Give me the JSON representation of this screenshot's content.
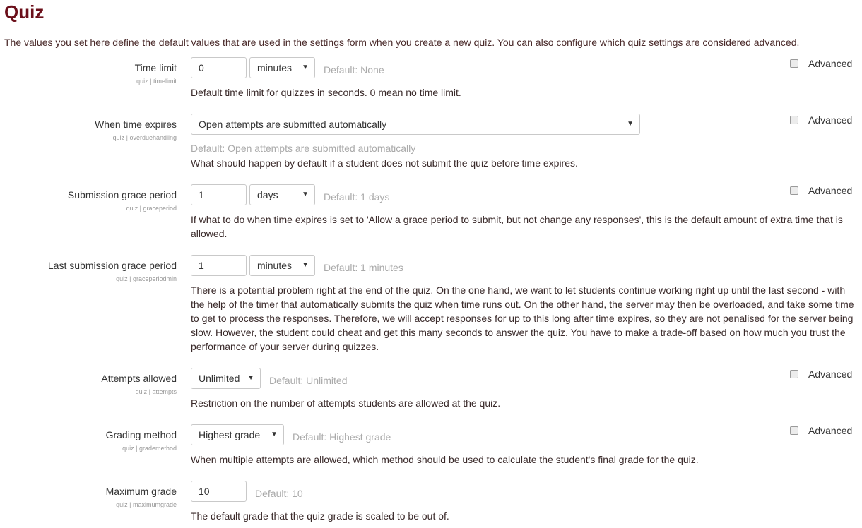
{
  "page": {
    "title": "Quiz",
    "intro": "The values you set here define the default values that are used in the settings form when you create a new quiz. You can also configure which quiz settings are considered advanced."
  },
  "advanced_label": "Advanced",
  "settings": {
    "time_limit": {
      "label": "Time limit",
      "key": "quiz | timelimit",
      "value": "0",
      "unit": "minutes",
      "default": "Default: None",
      "description": "Default time limit for quizzes in seconds. 0 mean no time limit."
    },
    "when_time_expires": {
      "label": "When time expires",
      "key": "quiz | overduehandling",
      "value": "Open attempts are submitted automatically",
      "default": "Default: Open attempts are submitted automatically",
      "description": "What should happen by default if a student does not submit the quiz before time expires."
    },
    "grace_period": {
      "label": "Submission grace period",
      "key": "quiz | graceperiod",
      "value": "1",
      "unit": "days",
      "default": "Default: 1 days",
      "description": "If what to do when time expires is set to 'Allow a grace period to submit, but not change any responses', this is the default amount of extra time that is allowed."
    },
    "last_grace_period": {
      "label": "Last submission grace period",
      "key": "quiz | graceperiodmin",
      "value": "1",
      "unit": "minutes",
      "default": "Default: 1 minutes",
      "description": "There is a potential problem right at the end of the quiz. On the one hand, we want to let students continue working right up until the last second - with the help of the timer that automatically submits the quiz when time runs out. On the other hand, the server may then be overloaded, and take some time to get to process the responses. Therefore, we will accept responses for up to this long after time expires, so they are not penalised for the server being slow. However, the student could cheat and get this many seconds to answer the quiz. You have to make a trade-off based on how much you trust the performance of your server during quizzes."
    },
    "attempts": {
      "label": "Attempts allowed",
      "key": "quiz | attempts",
      "value": "Unlimited",
      "default": "Default: Unlimited",
      "description": "Restriction on the number of attempts students are allowed at the quiz."
    },
    "grading_method": {
      "label": "Grading method",
      "key": "quiz | grademethod",
      "value": "Highest grade",
      "default": "Default: Highest grade",
      "description": "When multiple attempts are allowed, which method should be used to calculate the student's final grade for the quiz."
    },
    "maximum_grade": {
      "label": "Maximum grade",
      "key": "quiz | maximumgrade",
      "value": "10",
      "default": "Default: 10",
      "description": "The default grade that the quiz grade is scaled to be out of."
    }
  }
}
